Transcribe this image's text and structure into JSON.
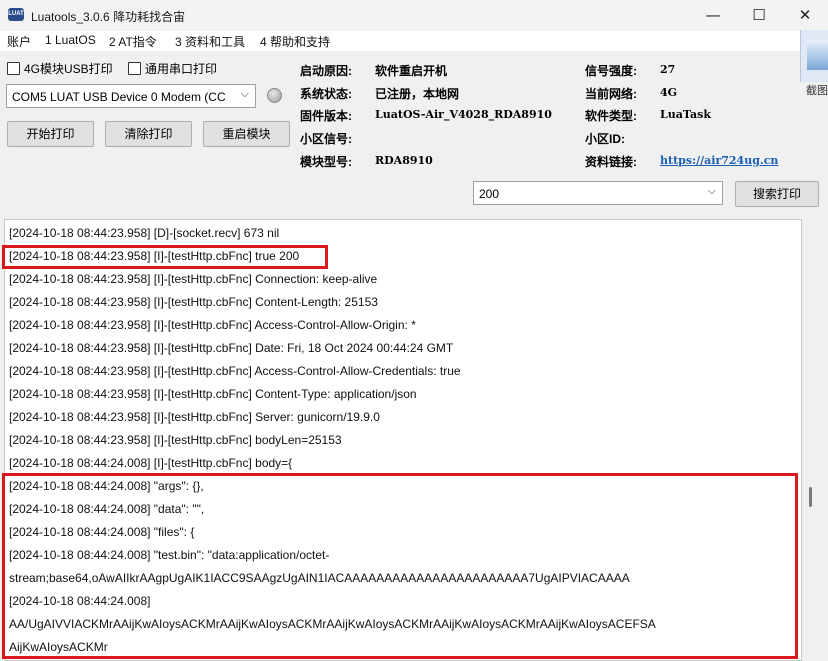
{
  "window": {
    "title": "Luatools_3.0.6 降功耗找合宙",
    "icon_text": "LUAT",
    "controls": {
      "minimize": "—",
      "maximize": "☐",
      "close": "✕"
    }
  },
  "menu": [
    "账户",
    "1 LuatOS",
    "2 AT指令",
    "3 资料和工具",
    "4 帮助和支持"
  ],
  "options": {
    "print_4g_usb": {
      "label": "4G模块USB打印",
      "checked": false
    },
    "print_serial": {
      "label": "通用串口打印",
      "checked": false
    }
  },
  "port_select": {
    "value": "COM5 LUAT USB Device 0 Modem (CC"
  },
  "buttons": {
    "start_print": "开始打印",
    "clear_print": "清除打印",
    "restart_module": "重启模块",
    "search_print": "搜索打印"
  },
  "device_info": {
    "boot_reason": {
      "label": "启动原因:",
      "value": "软件重启开机"
    },
    "system_status": {
      "label": "系统状态:",
      "value": "已注册，本地网"
    },
    "firmware": {
      "label": "固件版本:",
      "value": "LuatOS-Air_V4028_RDA8910"
    },
    "cell_signal": {
      "label": "小区信号:",
      "value": ""
    },
    "module_model": {
      "label": "模块型号:",
      "value": "RDA8910"
    },
    "signal_strength": {
      "label": "信号强度:",
      "value": "27"
    },
    "current_network": {
      "label": "当前网络:",
      "value": "4G"
    },
    "software_type": {
      "label": "软件类型:",
      "value": "LuaTask"
    },
    "cell_id": {
      "label": "小区ID:",
      "value": ""
    },
    "doc_link": {
      "label": "资料链接:",
      "value": "https://air724ug.cn"
    }
  },
  "search_filter": {
    "value": "200"
  },
  "side_label": "截图",
  "log_lines": [
    "[2024-10-18 08:44:23.958] [D]-[socket.recv] 673 nil",
    "[2024-10-18 08:44:23.958] [I]-[testHttp.cbFnc] true 200",
    "[2024-10-18 08:44:23.958] [I]-[testHttp.cbFnc] Connection: keep-alive",
    "[2024-10-18 08:44:23.958] [I]-[testHttp.cbFnc] Content-Length: 25153",
    "[2024-10-18 08:44:23.958] [I]-[testHttp.cbFnc] Access-Control-Allow-Origin: *",
    "[2024-10-18 08:44:23.958] [I]-[testHttp.cbFnc] Date: Fri, 18 Oct 2024 00:44:24 GMT",
    "[2024-10-18 08:44:23.958] [I]-[testHttp.cbFnc] Access-Control-Allow-Credentials: true",
    "[2024-10-18 08:44:23.958] [I]-[testHttp.cbFnc] Content-Type: application/json",
    "[2024-10-18 08:44:23.958] [I]-[testHttp.cbFnc] Server: gunicorn/19.9.0",
    "[2024-10-18 08:44:23.958] [I]-[testHttp.cbFnc] bodyLen=25153",
    "[2024-10-18 08:44:24.008] [I]-[testHttp.cbFnc] body={",
    "[2024-10-18 08:44:24.008]    \"args\": {},",
    "[2024-10-18 08:44:24.008]    \"data\": \"\",",
    "[2024-10-18 08:44:24.008]    \"files\": {",
    "[2024-10-18 08:44:24.008]        \"test.bin\": \"data:application/octet-",
    "stream;base64,oAwAIIkrAAgpUgAIK1IACC9SAAgzUgAIN1IACAAAAAAAAAAAAAAAAAAAAAAA7UgAIPVIACAAAA",
    "[2024-10-18 08:44:24.008]",
    "AA/UgAIVVIACKMrAAijKwAIoysACKMrAAijKwAIoysACKMrAAijKwAIoysACKMrAAijKwAIoysACKMrAAijKwAIoysACEFSA",
    "AijKwAIoysACKMr"
  ]
}
